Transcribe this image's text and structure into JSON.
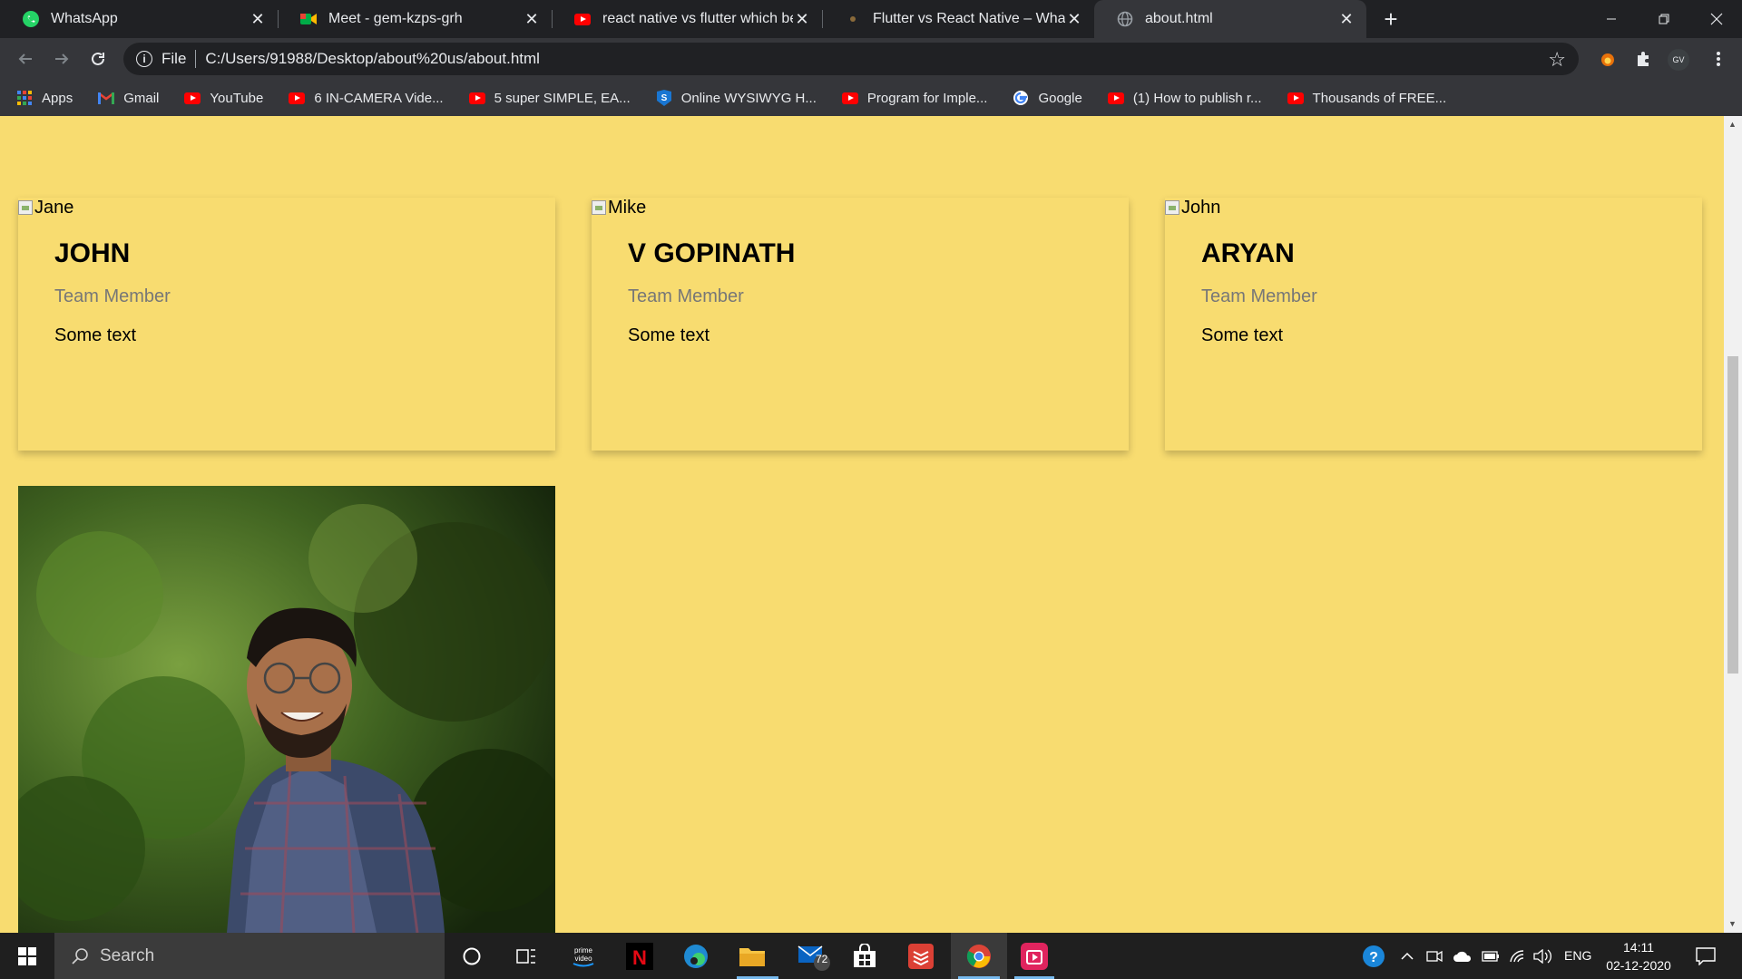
{
  "browser": {
    "tabs": [
      {
        "title": "WhatsApp",
        "icon": "whatsapp-icon",
        "active": false
      },
      {
        "title": "Meet - gem-kzps-grh",
        "icon": "meet-icon",
        "active": false
      },
      {
        "title": "react native vs flutter which best",
        "icon": "youtube-icon",
        "active": false
      },
      {
        "title": "Flutter vs React Native – What to",
        "icon": "site-icon",
        "active": false
      },
      {
        "title": "about.html",
        "icon": "globe-icon",
        "active": true
      }
    ],
    "omnibox": {
      "scheme": "File",
      "url": "C:/Users/91988/Desktop/about%20us/about.html"
    },
    "profile_initials": "GV",
    "bookmarks": [
      {
        "label": "Apps",
        "icon": "apps-grid-icon"
      },
      {
        "label": "Gmail",
        "icon": "gmail-icon"
      },
      {
        "label": "YouTube",
        "icon": "youtube-icon"
      },
      {
        "label": "6 IN-CAMERA Vide...",
        "icon": "youtube-icon"
      },
      {
        "label": "5 super SIMPLE, EA...",
        "icon": "youtube-icon"
      },
      {
        "label": "Online WYSIWYG H...",
        "icon": "wysiwyg-icon"
      },
      {
        "label": "Program for Imple...",
        "icon": "youtube-icon"
      },
      {
        "label": "Google",
        "icon": "google-icon"
      },
      {
        "label": "(1) How to publish r...",
        "icon": "youtube-icon"
      },
      {
        "label": "Thousands of FREE...",
        "icon": "youtube-icon"
      }
    ]
  },
  "page": {
    "background_color": "#f8dc70",
    "cards": [
      {
        "img_alt": "Jane",
        "name": "JOHN",
        "role": "Team Member",
        "text": "Some text"
      },
      {
        "img_alt": "Mike",
        "name": "V GOPINATH",
        "role": "Team Member",
        "text": "Some text"
      },
      {
        "img_alt": "John",
        "name": "ARYAN",
        "role": "Team Member",
        "text": "Some text"
      }
    ]
  },
  "taskbar": {
    "search_placeholder": "Search",
    "mail_badge": "72",
    "language": "ENG",
    "time": "14:11",
    "date": "02-12-2020"
  }
}
